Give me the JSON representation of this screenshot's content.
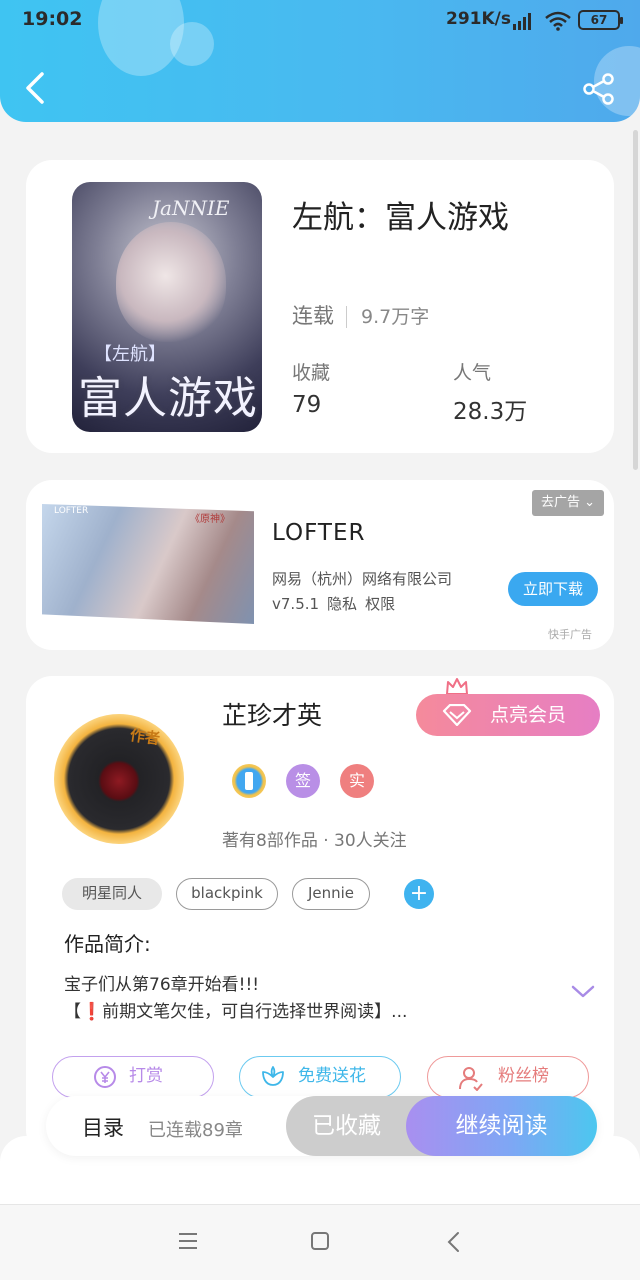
{
  "status_bar": {
    "time": "19:02",
    "network_speed": "291K/s",
    "battery": "67"
  },
  "book": {
    "title": "左航：富人游戏",
    "status": "连载",
    "word_count": "9.7万字",
    "favorites_label": "收藏",
    "favorites_value": "79",
    "popularity_label": "人气",
    "popularity_value": "28.3万",
    "cover": {
      "signature": "JaNNIE",
      "tag": "【左航】",
      "title": "富人游戏"
    }
  },
  "ad": {
    "app_name": "LOFTER",
    "company": "网易（杭州）网络有限公司",
    "version": "v7.5.1",
    "privacy": "隐私",
    "permissions": "权限",
    "close_label": "去广告",
    "download_label": "立即下载",
    "source": "快手广告",
    "image_tag": "LOFTER",
    "image_sub": "《原神》"
  },
  "author": {
    "avatar_label": "作者",
    "name": "芷珍才英",
    "vip_label": "点亮会员",
    "badges": [
      "签",
      "实"
    ],
    "stats": "著有8部作品 · 30人关注",
    "tags": [
      "明星同人",
      "blackpink",
      "Jennie"
    ],
    "intro_heading": "作品简介:",
    "intro_lines": [
      "宝子们从第76章开始看!!!",
      "【❗前期文笔欠佳，可自行选择世界阅读】..."
    ]
  },
  "actions": {
    "tip": "打赏",
    "flower": "免费送花",
    "fans": "粉丝榜"
  },
  "bottom_bar": {
    "toc_label": "目录",
    "chapter_status": "已连载89章",
    "favorite_label": "已收藏",
    "read_label": "继续阅读"
  },
  "colors": {
    "header": "#49b9f0",
    "accent_blue": "#3fb3ef",
    "vip_pink": "#f58a9b",
    "tip_purple": "#b78ae8",
    "flower_blue": "#3fb7e9",
    "fans_red": "#e57c7c"
  }
}
